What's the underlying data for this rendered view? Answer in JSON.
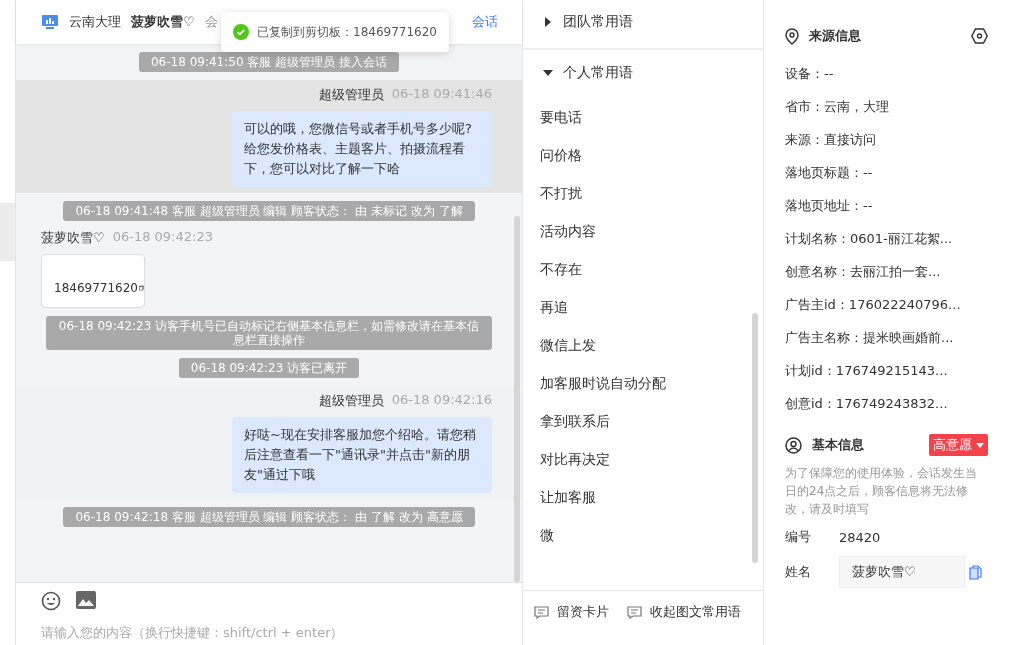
{
  "header": {
    "location": "云南大理",
    "visitor": "菠萝吹雪♡",
    "status_partial": "会",
    "link": "会话"
  },
  "toast": {
    "text": "已复制到剪切板：18469771620"
  },
  "messages": [
    {
      "kind": "system",
      "text": "06-18 09:41:50 客服 超级管理员 接入会话"
    },
    {
      "kind": "agent",
      "sender": "超级管理员",
      "time": "06-18 09:41:46",
      "text": "可以的哦，您微信号或者手机号多少呢?给您发价格表、主题客片、拍摄流程看下，您可以对比了解一下哈",
      "highlighted": true
    },
    {
      "kind": "system",
      "text": "06-18 09:41:48 客服 超级管理员 编辑 顾客状态： 由 未标记 改为 了解"
    },
    {
      "kind": "visitor",
      "sender": "菠萝吹雪♡",
      "time": "06-18 09:42:23",
      "phone": "18469771620"
    },
    {
      "kind": "system",
      "text": "06-18 09:42:23 访客手机号已自动标记右侧基本信息栏，如需修改请在基本信息栏直接操作"
    },
    {
      "kind": "system",
      "text": "06-18 09:42:23 访客已离开"
    },
    {
      "kind": "agent",
      "sender": "超级管理员",
      "time": "06-18 09:42:16",
      "text": "好哒~现在安排客服加您个绍哈。请您稍后注意查看一下\"通讯录\"并点击\"新的朋友\"通过下哦",
      "highlighted": false
    },
    {
      "kind": "system",
      "text": "06-18 09:42:18 客服 超级管理员 编辑 顾客状态： 由 了解 改为 高意愿"
    }
  ],
  "composer": {
    "placeholder": "请输入您的内容（换行快捷键：shift/ctrl + enter）"
  },
  "phrases": {
    "groups": [
      {
        "label": "团队常用语",
        "expanded": false
      },
      {
        "label": "个人常用语",
        "expanded": true
      }
    ],
    "items": [
      "要电话",
      "问价格",
      "不打扰",
      "活动内容",
      "不存在",
      "再追",
      "微信上发",
      "加客服时说自动分配",
      "拿到联系后",
      "对比再决定",
      "让加客服",
      "微"
    ],
    "toolbar": [
      "留资卡片",
      "收起图文常用语"
    ]
  },
  "source_info": {
    "title": "来源信息",
    "fields": [
      "设备：--",
      "省市：云南，大理",
      "来源：直接访问",
      "落地页标题：--",
      "落地页地址：--",
      "计划名称：0601-丽江花絮...",
      "创意名称：去丽江拍一套...",
      "广告主id：176022240796...",
      "广告主名称：提米映画婚前...",
      "计划id：176749215143...",
      "创意id：176749243832..."
    ]
  },
  "basic_info": {
    "title": "基本信息",
    "intent": "高意愿",
    "notice": "为了保障您的使用体验，会话发生当日的24点之后，顾客信息将无法修改，请及时填写",
    "fields": [
      {
        "kind": "text",
        "label": "编号",
        "value": "28420"
      },
      {
        "kind": "input",
        "label": "姓名",
        "value": "菠萝吹雪♡"
      }
    ]
  }
}
